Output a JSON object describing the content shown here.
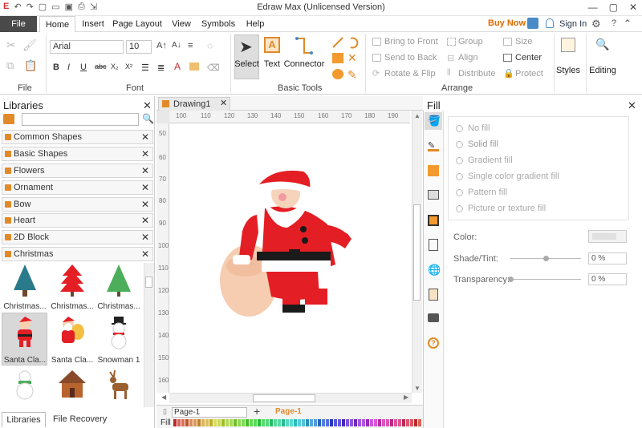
{
  "window": {
    "title": "Edraw Max (Unlicensed Version)"
  },
  "menu": {
    "file": "File",
    "home": "Home",
    "insert": "Insert",
    "page_layout": "Page Layout",
    "view": "View",
    "symbols": "Symbols",
    "help": "Help",
    "buy_now": "Buy Now",
    "sign_in": "Sign In"
  },
  "ribbon": {
    "font_name": "Arial",
    "font_size": "10",
    "groups": {
      "file": "File",
      "font": "Font",
      "basic_tools": "Basic Tools",
      "arrange": "Arrange"
    },
    "tools": {
      "select": "Select",
      "text": "Text",
      "connector": "Connector"
    },
    "arrange": {
      "bring_to_front": "Bring to Front",
      "send_to_back": "Send to Back",
      "rotate_flip": "Rotate & Flip",
      "group": "Group",
      "align": "Align",
      "distribute": "Distribute",
      "size": "Size",
      "center": "Center",
      "protect": "Protect"
    },
    "styles": "Styles",
    "editing": "Editing"
  },
  "libraries": {
    "title": "Libraries",
    "categories": [
      "Common Shapes",
      "Basic Shapes",
      "Flowers",
      "Ornament",
      "Bow",
      "Heart",
      "2D Block",
      "Christmas"
    ],
    "shapes": [
      "Christmas...",
      "Christmas...",
      "Christmas...",
      "Santa Cla...",
      "Santa Cla...",
      "Snowman 1"
    ],
    "tab_libraries": "Libraries",
    "tab_recovery": "File Recovery"
  },
  "document": {
    "tab": "Drawing1",
    "page_selector": "Page-1",
    "page_tab": "Page-1",
    "fill_label": "Fill"
  },
  "ruler": {
    "top": [
      "100",
      "110",
      "120",
      "130",
      "140",
      "150",
      "160",
      "170",
      "180",
      "190"
    ],
    "left": [
      "50",
      "60",
      "70",
      "80",
      "90",
      "100",
      "110",
      "120",
      "130",
      "140",
      "150",
      "160"
    ]
  },
  "fill_panel": {
    "title": "Fill",
    "options": [
      "No fill",
      "Solid fill",
      "Gradient fill",
      "Single color gradient fill",
      "Pattern fill",
      "Picture or texture fill"
    ],
    "color_label": "Color:",
    "shade_label": "Shade/Tint:",
    "transparency_label": "Transparency:",
    "shade_value": "0 %",
    "transparency_value": "0 %"
  },
  "colors": {
    "accent": "#e08a2a",
    "santa_red": "#e31e24",
    "file_tab": "#4a4a4a"
  }
}
